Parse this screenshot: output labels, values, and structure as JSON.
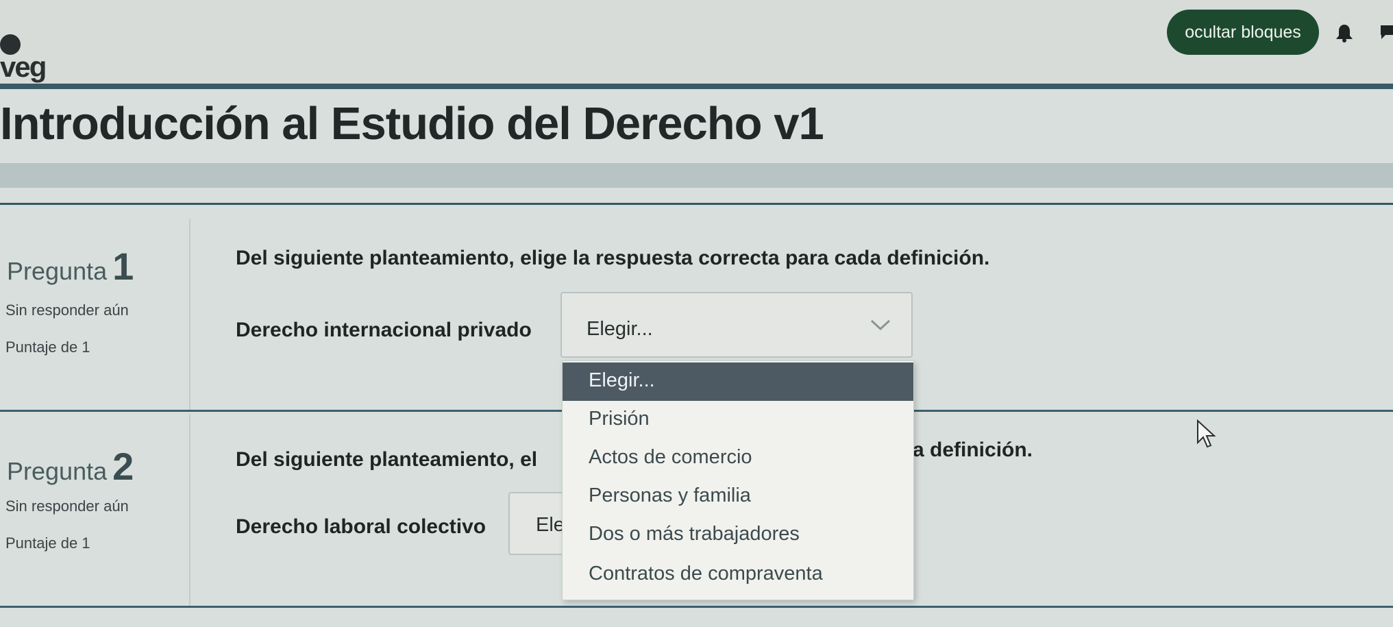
{
  "header": {
    "logo_text": "veg",
    "hide_blocks_label": "ocultar bloques",
    "bell_icon": "bell-icon",
    "chat_icon": "chat-icon"
  },
  "course": {
    "title": "Introducción al Estudio del Derecho v1"
  },
  "questions": [
    {
      "label": "Pregunta",
      "number": "1",
      "state": "Sin responder aún",
      "score": "Puntaje de 1",
      "prompt": "Del siguiente planteamiento, elige la respuesta correcta para cada definición.",
      "term": "Derecho internacional privado",
      "select_value": "Elegir..."
    },
    {
      "label": "Pregunta",
      "number": "2",
      "state": "Sin responder aún",
      "score": "Puntaje de 1",
      "prompt_visible_left": "Del siguiente planteamiento, el",
      "prompt_visible_right": "a definición.",
      "term": "Derecho laboral colectivo",
      "select_value_partial": "Ele"
    }
  ],
  "dropdown": {
    "options": [
      "Elegir...",
      "Prisión",
      "Actos de comercio",
      "Personas y familia",
      "Dos o más trabajadores",
      "Contratos de compraventa"
    ],
    "highlighted_index": 0
  },
  "colors": {
    "accent_button": "#1d4a2e",
    "highlight": "#4d5a63",
    "rule": "#3a5a66"
  }
}
